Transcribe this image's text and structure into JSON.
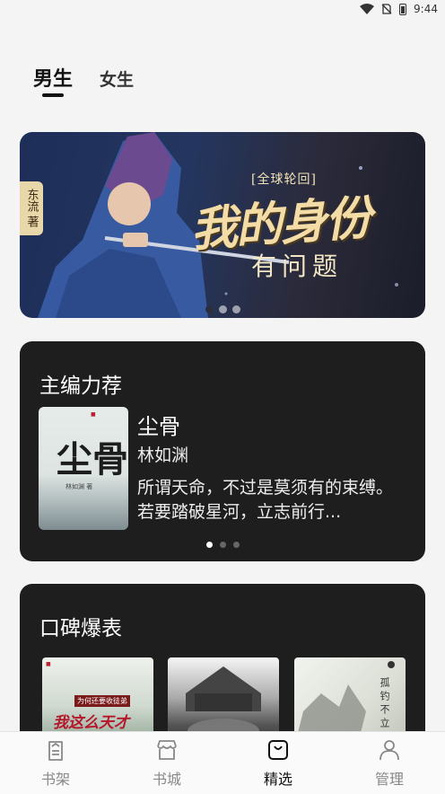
{
  "status_bar": {
    "time": "9:44"
  },
  "tabs": [
    {
      "label": "男生",
      "active": true
    },
    {
      "label": "女生",
      "active": false
    }
  ],
  "banner": {
    "tag": "[全球轮回]",
    "title": "我的身份",
    "subtitle": "有问题",
    "side_text": "东流 著",
    "page_count": 3,
    "active_index": 0
  },
  "editor_pick": {
    "section_title": "主编力荐",
    "book": {
      "cover_title": "尘骨",
      "cover_author": "林如渊 著",
      "name": "尘骨",
      "author": "林如渊",
      "description": "所谓天命，不过是莫须有的束缚。若要踏破星河，立志前行..."
    },
    "page_count": 3,
    "active_index": 0
  },
  "praised": {
    "section_title": "口碑爆表",
    "covers": [
      {
        "icon": "book-cover-1",
        "text": "我这么天才",
        "sub": "为何还要收徒弟"
      },
      {
        "icon": "book-cover-2"
      },
      {
        "icon": "book-cover-3",
        "text": "孤钓不立"
      }
    ]
  },
  "bottom_nav": [
    {
      "label": "书架",
      "icon": "bookshelf-icon",
      "active": false
    },
    {
      "label": "书城",
      "icon": "store-icon",
      "active": false
    },
    {
      "label": "精选",
      "icon": "featured-icon",
      "active": true
    },
    {
      "label": "管理",
      "icon": "user-icon",
      "active": false
    }
  ],
  "colors": {
    "card_bg": "#1e1e1e",
    "page_bg": "#f4f4f4",
    "banner_gold": "#f4dca6"
  }
}
